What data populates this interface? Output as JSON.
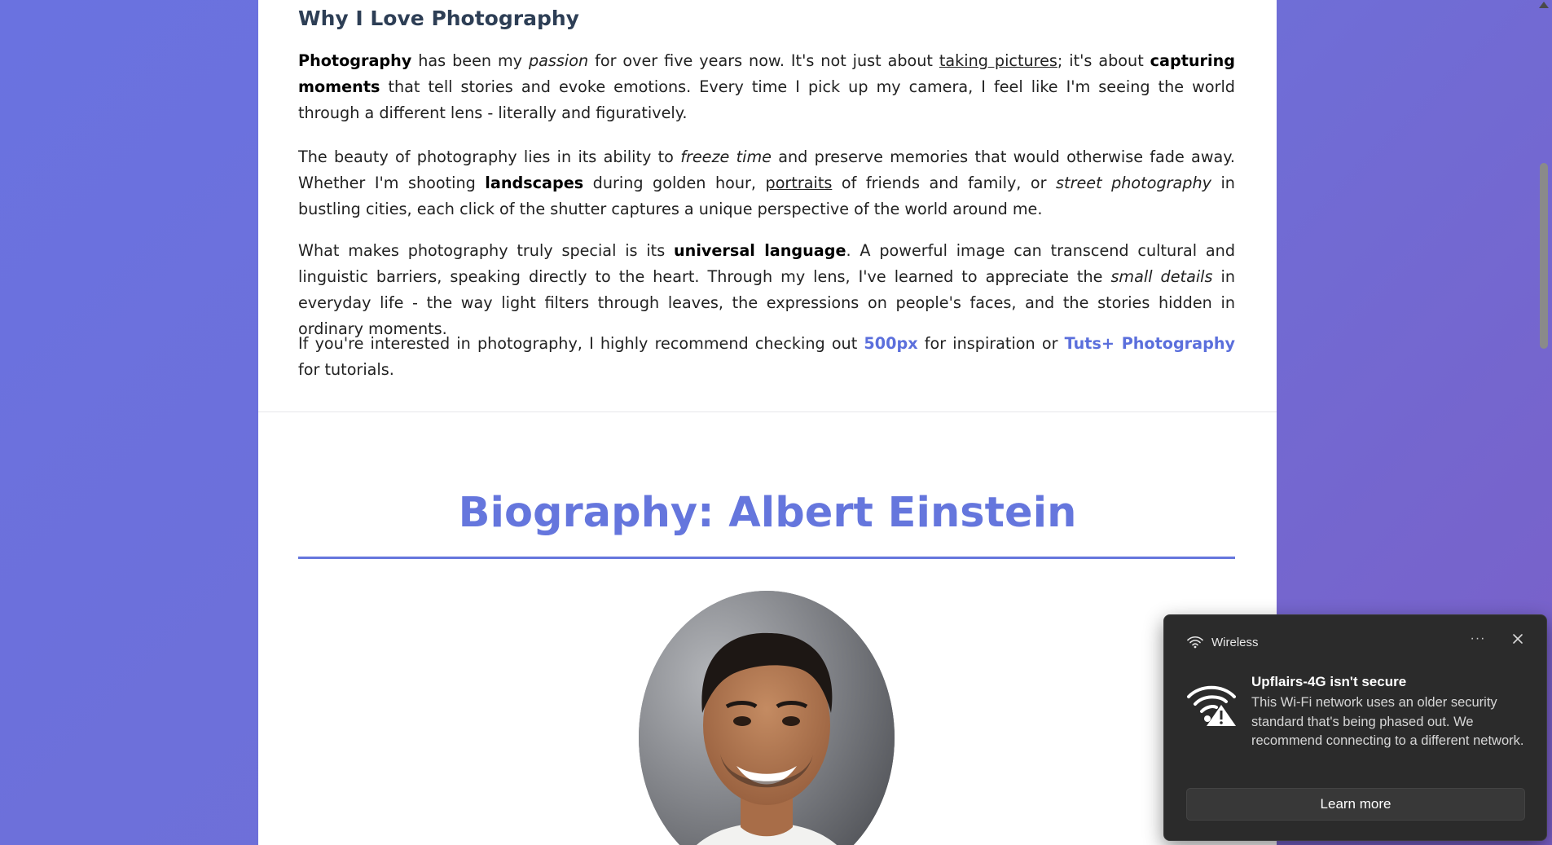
{
  "article": {
    "heading": "Why I Love Photography",
    "p1": {
      "s1_b": "Photography",
      "s2": " has been my ",
      "s3_i": "passion",
      "s4": " for over five years now. It's not just about ",
      "s5_u": "taking pictures",
      "s6": "; it's about ",
      "s7_b": "capturing moments",
      "s8": " that tell stories and evoke emotions. Every time I pick up my camera, I feel like I'm seeing the world through a different lens - literally and figuratively."
    },
    "p2": {
      "s1": "The beauty of photography lies in its ability to ",
      "s2_i": "freeze time",
      "s3": " and preserve memories that would otherwise fade away. Whether I'm shooting ",
      "s4_b": "landscapes",
      "s5": " during golden hour, ",
      "s6_u": "portraits",
      "s7": " of friends and family, or ",
      "s8_i": "street photography",
      "s9": " in bustling cities, each click of the shutter captures a unique perspective of the world around me."
    },
    "p3": {
      "s1": "What makes photography truly special is its ",
      "s2_b": "universal language",
      "s3": ". A powerful image can transcend cultural and linguistic barriers, speaking directly to the heart. Through my lens, I've learned to appreciate the ",
      "s4_i": "small details",
      "s5": " in everyday life - the way light filters through leaves, the expressions on people's faces, and the stories hidden in ordinary moments."
    },
    "p4": {
      "s1": "If you're interested in photography, I highly recommend checking out ",
      "link1": "500px",
      "s2": " for inspiration or ",
      "link2": "Tuts+ Photography",
      "s3": " for tutorials."
    }
  },
  "biography": {
    "title": "Biography: Albert Einstein",
    "portrait_icon": "person-photo"
  },
  "notification": {
    "app_name": "Wireless",
    "title": "Upflairs-4G isn't secure",
    "body": "This Wi-Fi network uses an older security standard that's being phased out. We recommend connecting to a different network.",
    "more_label": "···",
    "button_label": "Learn more",
    "icons": [
      "wifi-icon",
      "wifi-warning-icon",
      "more-icon",
      "close-icon"
    ]
  },
  "colors": {
    "accent": "#6576dd",
    "link": "#5b6fdc",
    "heading": "#2d3e55",
    "toast_bg": "#2b2b2b"
  }
}
